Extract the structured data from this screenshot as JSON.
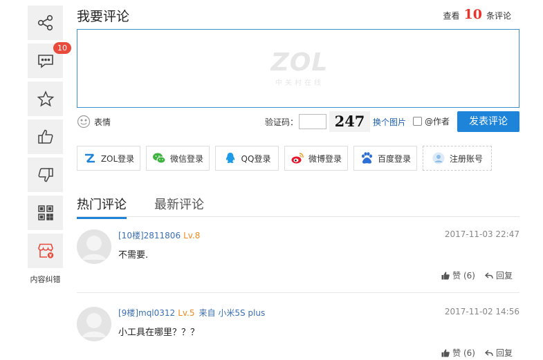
{
  "sidebar": {
    "badge_count": "10",
    "caption": "内容纠错",
    "items": [
      {
        "icon": "share-icon"
      },
      {
        "icon": "comment-icon"
      },
      {
        "icon": "star-icon"
      },
      {
        "icon": "thumbs-up-icon"
      },
      {
        "icon": "thumbs-down-icon"
      },
      {
        "icon": "qr-code-icon"
      },
      {
        "icon": "store-error-icon"
      }
    ]
  },
  "header": {
    "title": "我要评论",
    "view_prefix": "查看",
    "view_count": "10",
    "view_suffix": "条评论"
  },
  "comment_box": {
    "watermark_logo": "ZOL",
    "watermark_sub": "中关村在线"
  },
  "toolbar": {
    "emoji_label": "表情",
    "captcha_label": "验证码：",
    "captcha_value": "",
    "captcha_code": "247",
    "refresh_label": "换个图片",
    "at_author_label": "@作者",
    "submit_label": "发表评论"
  },
  "logins": [
    {
      "label": "ZOL登录",
      "icon": "zol-icon"
    },
    {
      "label": "微信登录",
      "icon": "wechat-icon"
    },
    {
      "label": "QQ登录",
      "icon": "qq-icon"
    },
    {
      "label": "微博登录",
      "icon": "weibo-icon"
    },
    {
      "label": "百度登录",
      "icon": "baidu-icon"
    },
    {
      "label": "注册账号",
      "icon": "user-icon"
    }
  ],
  "tabs": [
    {
      "label": "热门评论",
      "active": true
    },
    {
      "label": "最新评论",
      "active": false
    }
  ],
  "comments": [
    {
      "floor_user": "[10楼]2811806",
      "level": "Lv.8",
      "from": "",
      "time": "2017-11-03 22:47",
      "text": "不需要.",
      "likes_label": "赞 (6)",
      "reply_label": "回复"
    },
    {
      "floor_user": "[9楼]mql0312",
      "level": "Lv.5",
      "from": "来自 小米5S plus",
      "time": "2017-11-02 14:56",
      "text": "小工具在哪里？？？",
      "likes_label": "赞 (6)",
      "reply_label": "回复"
    }
  ],
  "colors": {
    "accent": "#1e84d9",
    "badge": "#e84a3b",
    "count": "#e8352b",
    "level": "#f08a1c",
    "username": "#3b6fb3"
  }
}
